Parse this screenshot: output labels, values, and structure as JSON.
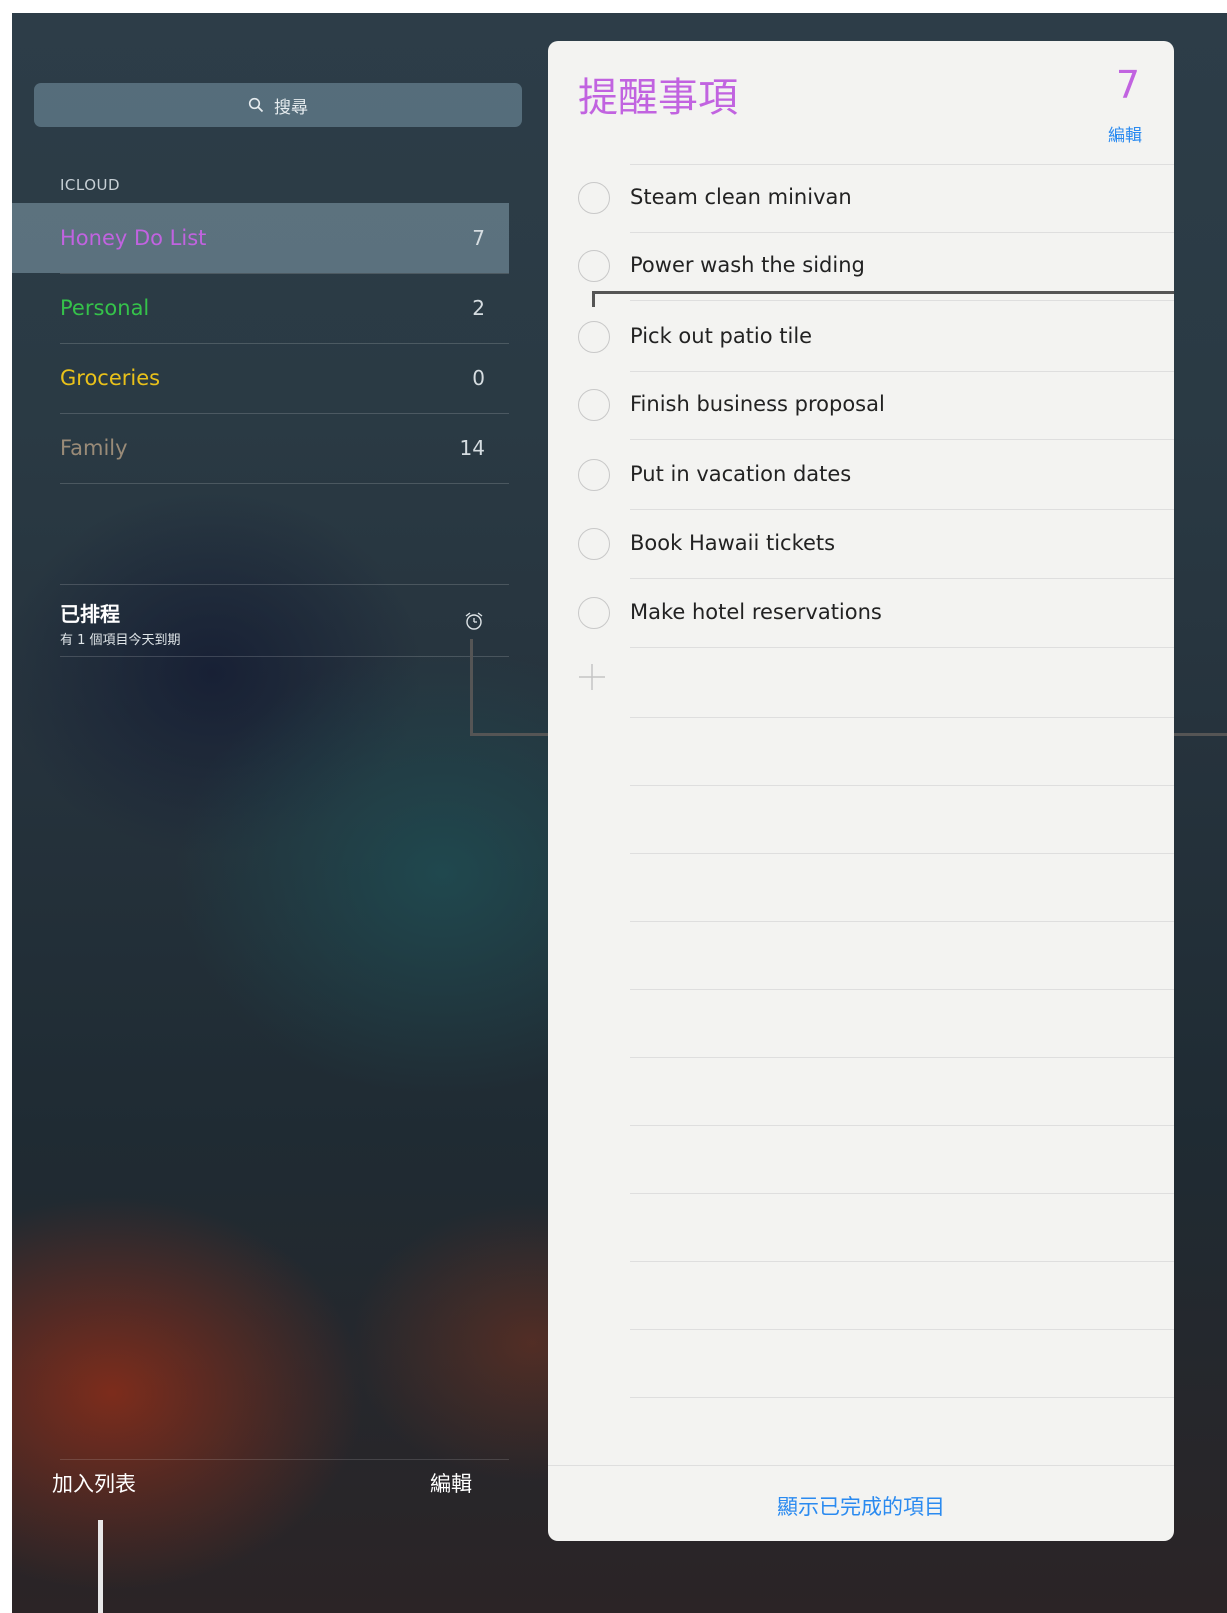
{
  "search": {
    "placeholder": "搜尋"
  },
  "sidebar": {
    "section_header": "ICLOUD",
    "lists": [
      {
        "name": "Honey Do List",
        "count": "7",
        "color": "#c163e0",
        "selected": true
      },
      {
        "name": "Personal",
        "count": "2",
        "color": "#35c24a",
        "selected": false
      },
      {
        "name": "Groceries",
        "count": "0",
        "color": "#e9c11a",
        "selected": false
      },
      {
        "name": "Family",
        "count": "14",
        "color": "#9a8b78",
        "selected": false
      }
    ],
    "scheduled": {
      "title": "已排程",
      "subtitle": "有 1 個項目今天到期",
      "icon": "alarm-clock-icon"
    },
    "footer": {
      "add_list": "加入列表",
      "edit": "編輯"
    }
  },
  "panel": {
    "title": "提醒事項",
    "count": "7",
    "edit": "編輯",
    "tasks": [
      "Steam clean minivan",
      "Power wash the siding",
      "Pick out patio tile",
      "Finish business proposal",
      "Put in vacation dates",
      "Book Hawaii tickets",
      "Make hotel reservations"
    ],
    "show_completed": "顯示已完成的項目"
  },
  "colors": {
    "accent_purple": "#c163e0",
    "link_blue": "#2a8af0"
  }
}
